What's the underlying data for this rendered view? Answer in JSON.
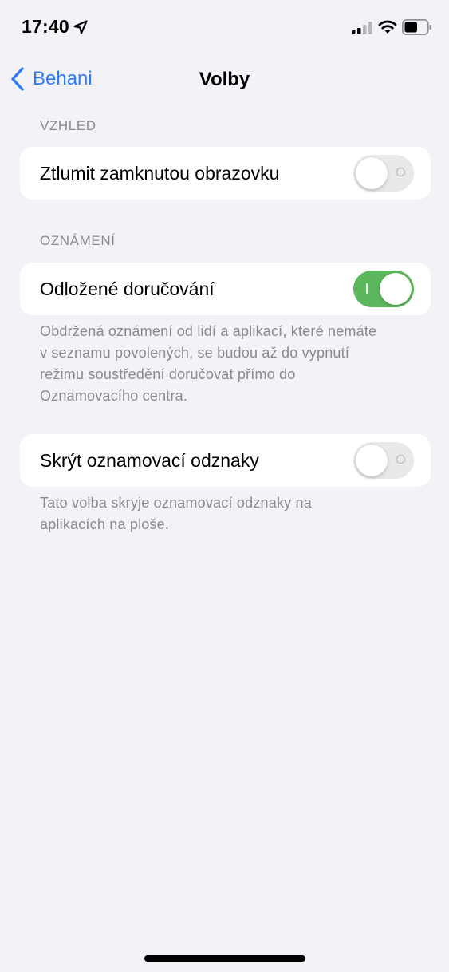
{
  "status_bar": {
    "time": "17:40",
    "location_icon": "location-arrow-icon",
    "signal_icon": "cellular-signal-icon",
    "wifi_icon": "wifi-icon",
    "battery_icon": "battery-icon"
  },
  "nav": {
    "back_label": "Behani",
    "title": "Volby"
  },
  "sections": {
    "appearance": {
      "header": "VZHLED",
      "row_label": "Ztlumit zamknutou obrazovku",
      "toggle_on": false
    },
    "notifications": {
      "header": "OZNÁMENÍ",
      "delayed_label": "Odložené doručování",
      "delayed_on": true,
      "delayed_footer_lines": [
        "Obdržená oznámení od lidí a aplikací, které nemáte",
        "v seznamu povolených, se budou až do vypnutí",
        "režimu soustředění doručovat přímo do",
        "Oznamovacího centra."
      ],
      "badges_label": "Skrýt oznamovací odznaky",
      "badges_on": false,
      "badges_footer_lines": [
        "Tato volba skryje oznamovací odznaky na",
        "aplikacích na ploše."
      ]
    }
  },
  "colors": {
    "accent": "#2f7cf6",
    "toggle_on": "#5cb85c",
    "toggle_off": "#e9e9ea",
    "background": "#f2f2f7"
  }
}
